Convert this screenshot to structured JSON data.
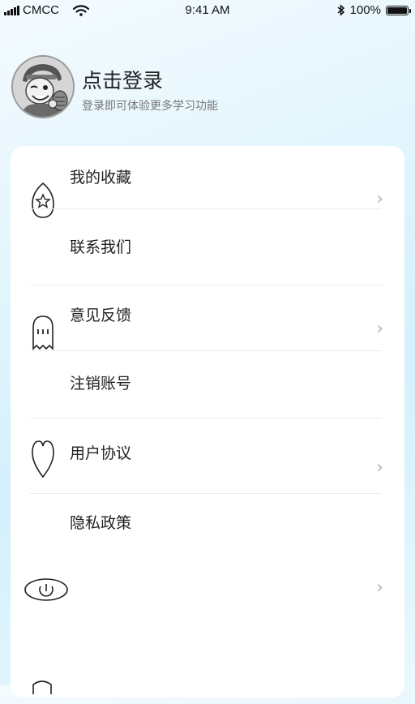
{
  "status_bar": {
    "carrier": "CMCC",
    "time": "9:41 AM",
    "battery_percent": "100%",
    "battery_level": 1.0,
    "icons": [
      "signal-icon",
      "wifi-icon",
      "bluetooth-icon",
      "battery-icon"
    ]
  },
  "profile": {
    "title": "点击登录",
    "subtitle": "登录即可体验更多学习功能",
    "avatar_icon": "cartoon-avatar"
  },
  "menu": {
    "items": [
      {
        "label": "我的收藏",
        "icon": "star-tag-icon",
        "chevron": true
      },
      {
        "label": "联系我们",
        "icon": "",
        "chevron": false
      },
      {
        "label": "意见反馈",
        "icon": "ghost-icon",
        "chevron": true
      },
      {
        "label": "注销账号",
        "icon": "",
        "chevron": false
      },
      {
        "label": "用户协议",
        "icon": "heart-icon",
        "chevron": true
      },
      {
        "label": "隐私政策",
        "icon": "",
        "chevron": false
      },
      {
        "label": "",
        "icon": "power-icon",
        "chevron": true
      }
    ]
  },
  "colors": {
    "background_gradient_top": "#f4fbff",
    "background_gradient_accent": "#d3f0fb",
    "card": "#ffffff",
    "divider": "#ececec",
    "subtitle": "#777777",
    "chevron": "#b5b5b5"
  }
}
